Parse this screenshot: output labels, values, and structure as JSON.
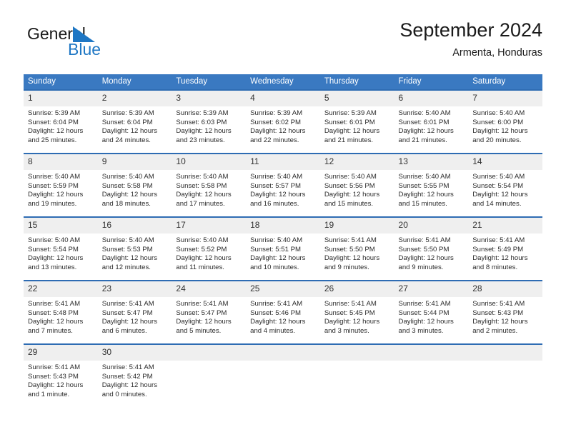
{
  "brand": {
    "name_part1": "General",
    "name_part2": "Blue",
    "accent_color": "#1f77c4"
  },
  "header": {
    "title": "September 2024",
    "location": "Armenta, Honduras"
  },
  "calendar": {
    "header_bg": "#3a79c1",
    "daynum_bg": "#efefef",
    "weekdays": [
      "Sunday",
      "Monday",
      "Tuesday",
      "Wednesday",
      "Thursday",
      "Friday",
      "Saturday"
    ],
    "weeks": [
      [
        {
          "day": "1",
          "sunrise": "Sunrise: 5:39 AM",
          "sunset": "Sunset: 6:04 PM",
          "daylight_line1": "Daylight: 12 hours",
          "daylight_line2": "and 25 minutes."
        },
        {
          "day": "2",
          "sunrise": "Sunrise: 5:39 AM",
          "sunset": "Sunset: 6:04 PM",
          "daylight_line1": "Daylight: 12 hours",
          "daylight_line2": "and 24 minutes."
        },
        {
          "day": "3",
          "sunrise": "Sunrise: 5:39 AM",
          "sunset": "Sunset: 6:03 PM",
          "daylight_line1": "Daylight: 12 hours",
          "daylight_line2": "and 23 minutes."
        },
        {
          "day": "4",
          "sunrise": "Sunrise: 5:39 AM",
          "sunset": "Sunset: 6:02 PM",
          "daylight_line1": "Daylight: 12 hours",
          "daylight_line2": "and 22 minutes."
        },
        {
          "day": "5",
          "sunrise": "Sunrise: 5:39 AM",
          "sunset": "Sunset: 6:01 PM",
          "daylight_line1": "Daylight: 12 hours",
          "daylight_line2": "and 21 minutes."
        },
        {
          "day": "6",
          "sunrise": "Sunrise: 5:40 AM",
          "sunset": "Sunset: 6:01 PM",
          "daylight_line1": "Daylight: 12 hours",
          "daylight_line2": "and 21 minutes."
        },
        {
          "day": "7",
          "sunrise": "Sunrise: 5:40 AM",
          "sunset": "Sunset: 6:00 PM",
          "daylight_line1": "Daylight: 12 hours",
          "daylight_line2": "and 20 minutes."
        }
      ],
      [
        {
          "day": "8",
          "sunrise": "Sunrise: 5:40 AM",
          "sunset": "Sunset: 5:59 PM",
          "daylight_line1": "Daylight: 12 hours",
          "daylight_line2": "and 19 minutes."
        },
        {
          "day": "9",
          "sunrise": "Sunrise: 5:40 AM",
          "sunset": "Sunset: 5:58 PM",
          "daylight_line1": "Daylight: 12 hours",
          "daylight_line2": "and 18 minutes."
        },
        {
          "day": "10",
          "sunrise": "Sunrise: 5:40 AM",
          "sunset": "Sunset: 5:58 PM",
          "daylight_line1": "Daylight: 12 hours",
          "daylight_line2": "and 17 minutes."
        },
        {
          "day": "11",
          "sunrise": "Sunrise: 5:40 AM",
          "sunset": "Sunset: 5:57 PM",
          "daylight_line1": "Daylight: 12 hours",
          "daylight_line2": "and 16 minutes."
        },
        {
          "day": "12",
          "sunrise": "Sunrise: 5:40 AM",
          "sunset": "Sunset: 5:56 PM",
          "daylight_line1": "Daylight: 12 hours",
          "daylight_line2": "and 15 minutes."
        },
        {
          "day": "13",
          "sunrise": "Sunrise: 5:40 AM",
          "sunset": "Sunset: 5:55 PM",
          "daylight_line1": "Daylight: 12 hours",
          "daylight_line2": "and 15 minutes."
        },
        {
          "day": "14",
          "sunrise": "Sunrise: 5:40 AM",
          "sunset": "Sunset: 5:54 PM",
          "daylight_line1": "Daylight: 12 hours",
          "daylight_line2": "and 14 minutes."
        }
      ],
      [
        {
          "day": "15",
          "sunrise": "Sunrise: 5:40 AM",
          "sunset": "Sunset: 5:54 PM",
          "daylight_line1": "Daylight: 12 hours",
          "daylight_line2": "and 13 minutes."
        },
        {
          "day": "16",
          "sunrise": "Sunrise: 5:40 AM",
          "sunset": "Sunset: 5:53 PM",
          "daylight_line1": "Daylight: 12 hours",
          "daylight_line2": "and 12 minutes."
        },
        {
          "day": "17",
          "sunrise": "Sunrise: 5:40 AM",
          "sunset": "Sunset: 5:52 PM",
          "daylight_line1": "Daylight: 12 hours",
          "daylight_line2": "and 11 minutes."
        },
        {
          "day": "18",
          "sunrise": "Sunrise: 5:40 AM",
          "sunset": "Sunset: 5:51 PM",
          "daylight_line1": "Daylight: 12 hours",
          "daylight_line2": "and 10 minutes."
        },
        {
          "day": "19",
          "sunrise": "Sunrise: 5:41 AM",
          "sunset": "Sunset: 5:50 PM",
          "daylight_line1": "Daylight: 12 hours",
          "daylight_line2": "and 9 minutes."
        },
        {
          "day": "20",
          "sunrise": "Sunrise: 5:41 AM",
          "sunset": "Sunset: 5:50 PM",
          "daylight_line1": "Daylight: 12 hours",
          "daylight_line2": "and 9 minutes."
        },
        {
          "day": "21",
          "sunrise": "Sunrise: 5:41 AM",
          "sunset": "Sunset: 5:49 PM",
          "daylight_line1": "Daylight: 12 hours",
          "daylight_line2": "and 8 minutes."
        }
      ],
      [
        {
          "day": "22",
          "sunrise": "Sunrise: 5:41 AM",
          "sunset": "Sunset: 5:48 PM",
          "daylight_line1": "Daylight: 12 hours",
          "daylight_line2": "and 7 minutes."
        },
        {
          "day": "23",
          "sunrise": "Sunrise: 5:41 AM",
          "sunset": "Sunset: 5:47 PM",
          "daylight_line1": "Daylight: 12 hours",
          "daylight_line2": "and 6 minutes."
        },
        {
          "day": "24",
          "sunrise": "Sunrise: 5:41 AM",
          "sunset": "Sunset: 5:47 PM",
          "daylight_line1": "Daylight: 12 hours",
          "daylight_line2": "and 5 minutes."
        },
        {
          "day": "25",
          "sunrise": "Sunrise: 5:41 AM",
          "sunset": "Sunset: 5:46 PM",
          "daylight_line1": "Daylight: 12 hours",
          "daylight_line2": "and 4 minutes."
        },
        {
          "day": "26",
          "sunrise": "Sunrise: 5:41 AM",
          "sunset": "Sunset: 5:45 PM",
          "daylight_line1": "Daylight: 12 hours",
          "daylight_line2": "and 3 minutes."
        },
        {
          "day": "27",
          "sunrise": "Sunrise: 5:41 AM",
          "sunset": "Sunset: 5:44 PM",
          "daylight_line1": "Daylight: 12 hours",
          "daylight_line2": "and 3 minutes."
        },
        {
          "day": "28",
          "sunrise": "Sunrise: 5:41 AM",
          "sunset": "Sunset: 5:43 PM",
          "daylight_line1": "Daylight: 12 hours",
          "daylight_line2": "and 2 minutes."
        }
      ],
      [
        {
          "day": "29",
          "sunrise": "Sunrise: 5:41 AM",
          "sunset": "Sunset: 5:43 PM",
          "daylight_line1": "Daylight: 12 hours",
          "daylight_line2": "and 1 minute."
        },
        {
          "day": "30",
          "sunrise": "Sunrise: 5:41 AM",
          "sunset": "Sunset: 5:42 PM",
          "daylight_line1": "Daylight: 12 hours",
          "daylight_line2": "and 0 minutes."
        },
        {
          "day": "",
          "sunrise": "",
          "sunset": "",
          "daylight_line1": "",
          "daylight_line2": ""
        },
        {
          "day": "",
          "sunrise": "",
          "sunset": "",
          "daylight_line1": "",
          "daylight_line2": ""
        },
        {
          "day": "",
          "sunrise": "",
          "sunset": "",
          "daylight_line1": "",
          "daylight_line2": ""
        },
        {
          "day": "",
          "sunrise": "",
          "sunset": "",
          "daylight_line1": "",
          "daylight_line2": ""
        },
        {
          "day": "",
          "sunrise": "",
          "sunset": "",
          "daylight_line1": "",
          "daylight_line2": ""
        }
      ]
    ]
  }
}
